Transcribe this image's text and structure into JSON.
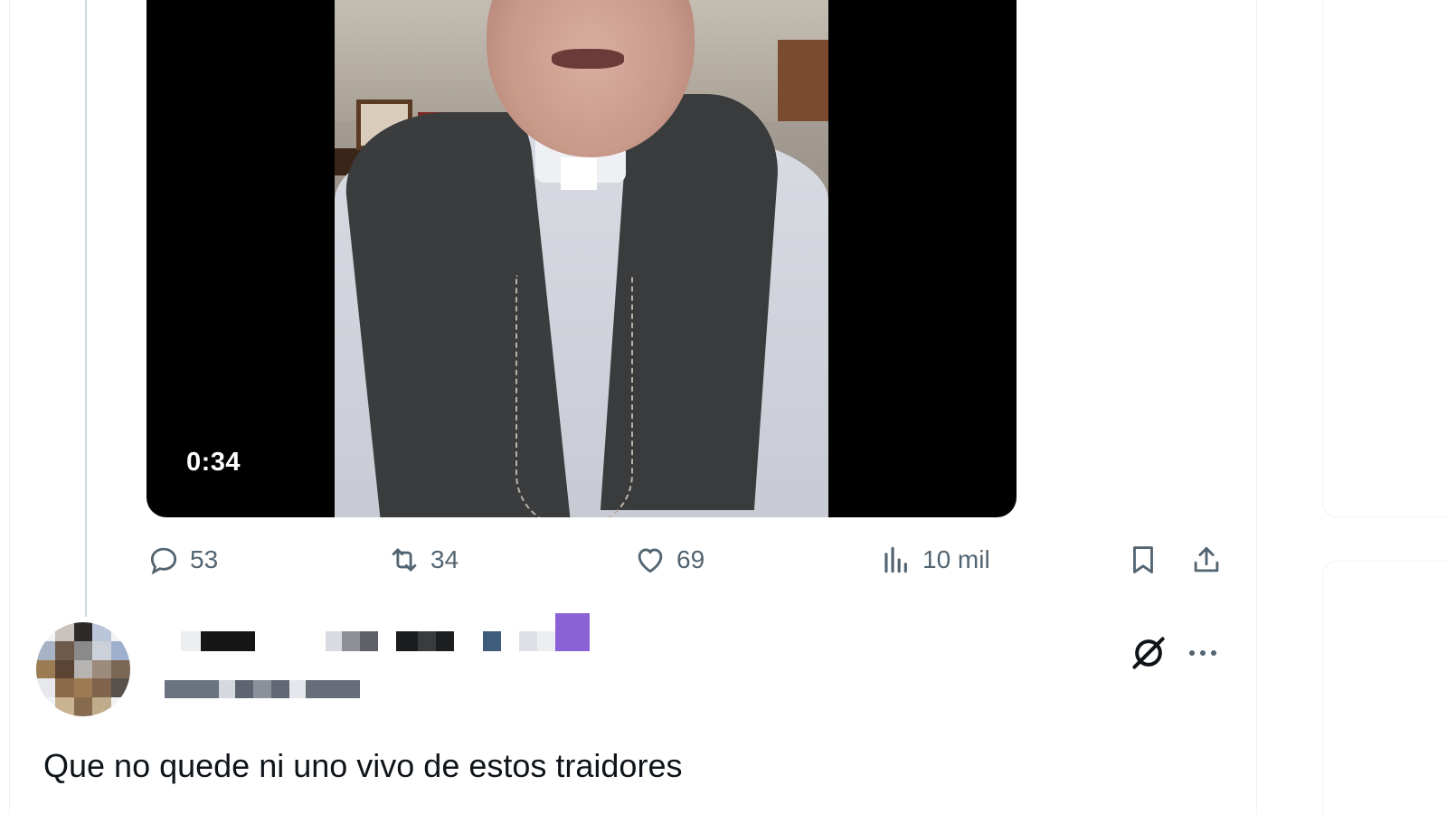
{
  "video": {
    "duration": "0:34"
  },
  "actions": {
    "replies": "53",
    "reposts": "34",
    "likes": "69",
    "views": "10 mil"
  },
  "reply": {
    "text": "Que no quede ni uno vivo de estos traidores",
    "accent_color": "#8b62d6"
  },
  "colors": {
    "icon_gray": "#536471",
    "text": "#0f1419",
    "border": "#eff3f4"
  },
  "icons": [
    "reply-icon",
    "retweet-icon",
    "heart-icon",
    "views-icon",
    "bookmark-icon",
    "share-icon",
    "grok-icon",
    "more-icon"
  ]
}
